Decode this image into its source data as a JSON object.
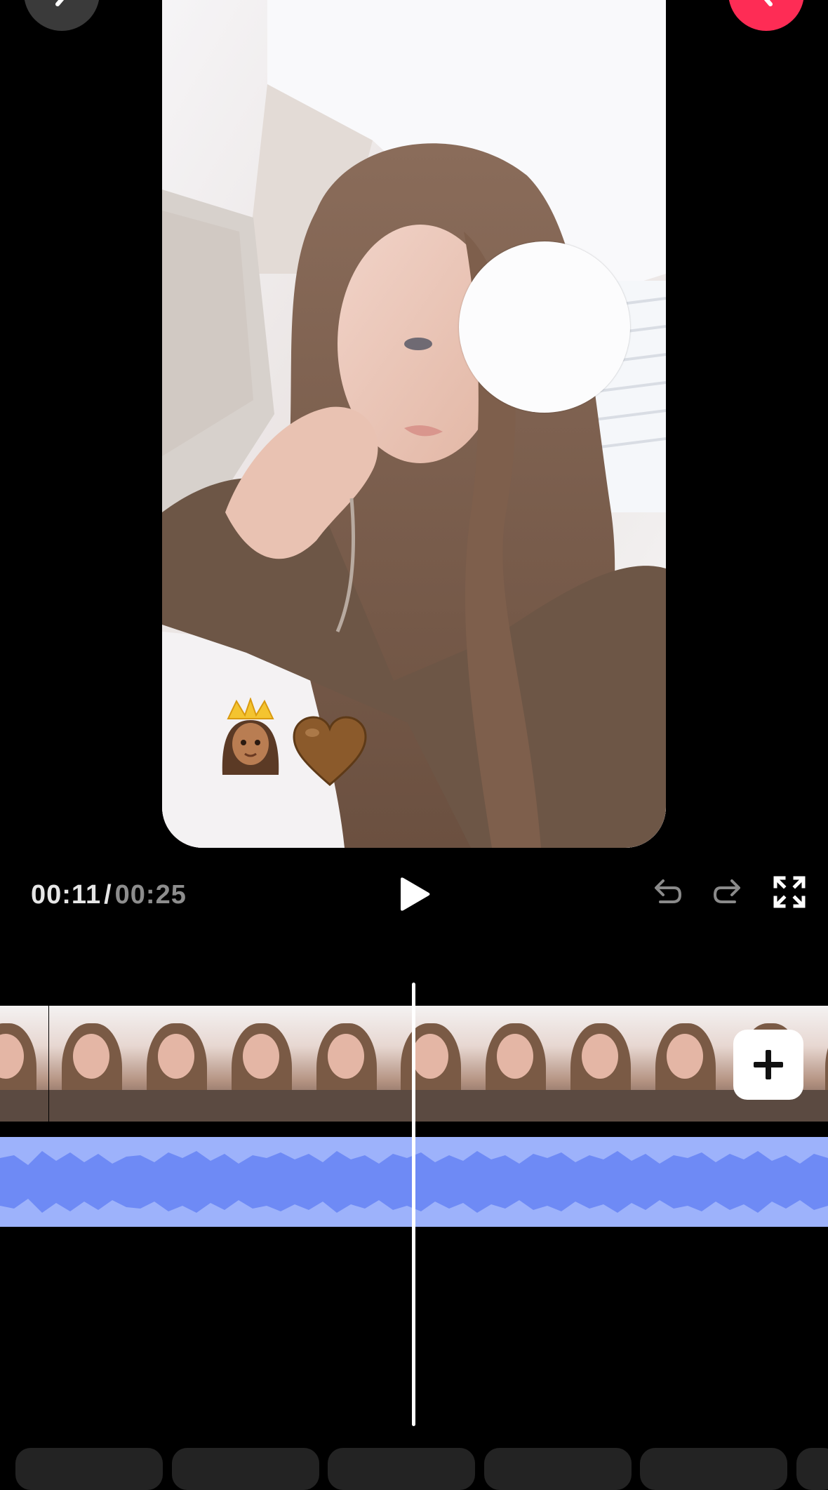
{
  "player": {
    "current_time": "00:11",
    "separator": "/",
    "total_time": "00:25"
  },
  "preview": {
    "stickers": [
      "👸🏽",
      "🤎"
    ]
  },
  "icons": {
    "back": "chevron-left-icon",
    "next": "chevron-right-icon",
    "play": "play-icon",
    "undo": "undo-icon",
    "redo": "redo-icon",
    "fullscreen": "fullscreen-icon",
    "add": "plus-icon"
  },
  "colors": {
    "background": "#000000",
    "next_button": "#fe2c55",
    "audio_track": "#9db2fb",
    "waveform": "#6e8af5"
  },
  "timeline": {
    "frame_count": 10
  }
}
